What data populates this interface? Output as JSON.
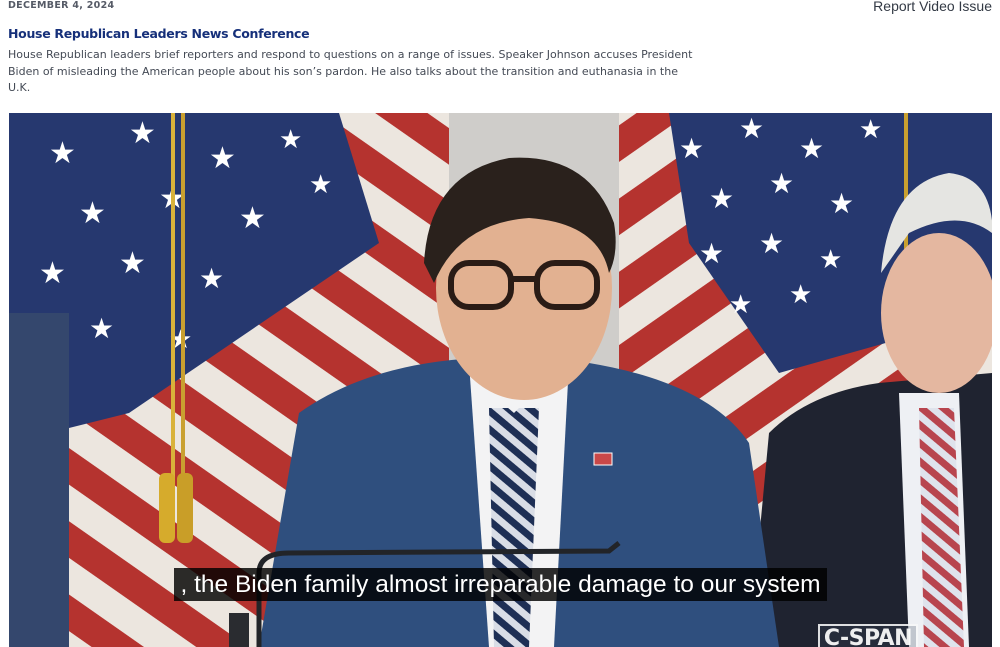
{
  "meta": {
    "date": "DECEMBER 4, 2024",
    "report_label": "Report Video Issue"
  },
  "program": {
    "title": "House Republican Leaders News Conference",
    "description": "House Republican leaders brief reporters and respond to questions on a range of issues. Speaker Johnson accuses President Biden of misleading the American people about his son’s pardon. He also talks about the transition and euthanasia in the U.K."
  },
  "video": {
    "caption": ", the Biden family almost irreparable damage to our system",
    "watermark": "C-SPAN"
  },
  "colors": {
    "title": "#16307a",
    "flag_blue": "#2a3c7a",
    "flag_red": "#b5332f",
    "suit": "#2f4f7e"
  }
}
